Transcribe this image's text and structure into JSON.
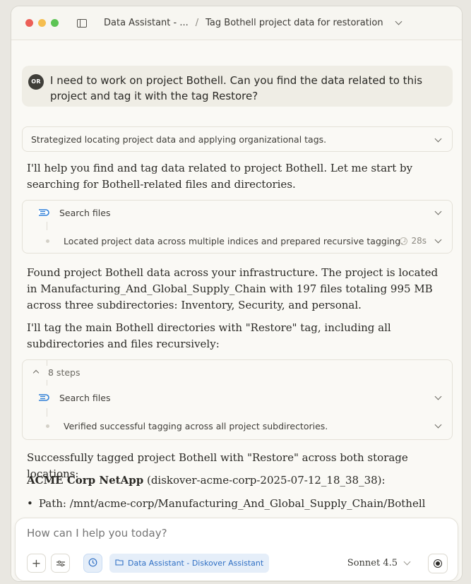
{
  "titlebar": {
    "project_crumb": "Data Assistant - ...",
    "separator": "/",
    "chat_title": "Tag Bothell project data for restoration"
  },
  "user_message": {
    "avatar_initials": "OR",
    "text": "I need to work on project Bothell. Can you find the data related to this project and tag it with the tag Restore?"
  },
  "thinking_summary": "Strategized locating project data and applying organizational tags.",
  "paragraphs": {
    "p1": "I'll help you find and tag data related to project Bothell. Let me start by searching for Bothell-related files and directories.",
    "p2": "Found project Bothell data across your infrastructure. The project is located in Manufacturing_And_Global_Supply_Chain with 197 files totaling 995 MB across three subdirectories: Inventory, Security, and personal.",
    "p3": "I'll tag the main Bothell directories with \"Restore\" tag, including all subdirectories and files recursively:",
    "p4": "Successfully tagged project Bothell with \"Restore\" across both storage locations:",
    "p5_bold": "ACME Corp NetApp",
    "p5_rest": " (diskover-acme-corp-2025-07-12_18_38_38):",
    "p6_bullet": "Path: /mnt/acme-corp/Manufacturing_And_Global_Supply_Chain/Bothell"
  },
  "tool_block_1": {
    "tool_label": "Search files",
    "summary": "Located project data across multiple indices and prepared recursive tagging.",
    "duration": "28s"
  },
  "tool_block_2": {
    "steps_label": "8 steps",
    "tool_label": "Search files",
    "summary": "Verified successful tagging across all project subdirectories."
  },
  "composer": {
    "placeholder": "How can I help you today?",
    "plus_label": "+",
    "project_chip": "Data Assistant - Diskover Assistant",
    "model": "Sonnet 4.5"
  },
  "colors": {
    "accent_blue": "#2f6fc4",
    "traffic_red": "#ec5f57",
    "traffic_yellow": "#f5be4f",
    "traffic_green": "#5dc454"
  }
}
